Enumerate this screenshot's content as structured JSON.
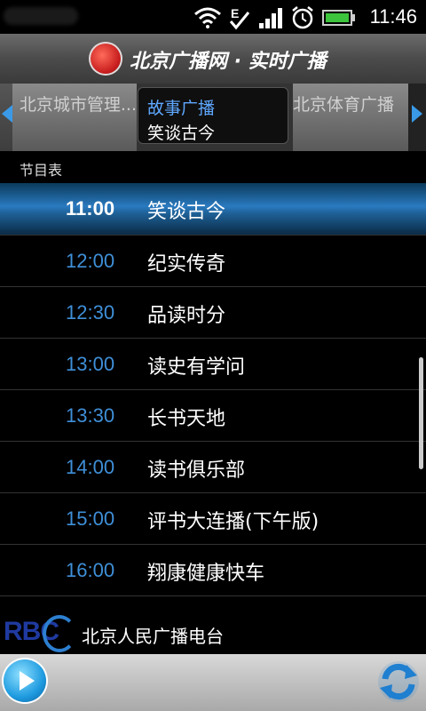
{
  "status_bar": {
    "time": "11:46",
    "icons": [
      "wifi-icon",
      "signal-E-check-icon",
      "signal-bars-icon",
      "alarm-icon",
      "battery-icon"
    ]
  },
  "header": {
    "title": "北京广播网 · 实时广播",
    "logo_icon": "beijing-radio-logo"
  },
  "channels": {
    "prev": "北京城市管理...",
    "current_channel": "故事广播",
    "current_program": "笑谈古今",
    "next": "北京体育广播"
  },
  "schedule": {
    "label": "节目表",
    "items": [
      {
        "time": "11:00",
        "program": "笑谈古今",
        "active": true
      },
      {
        "time": "12:00",
        "program": "纪实传奇"
      },
      {
        "time": "12:30",
        "program": "品读时分"
      },
      {
        "time": "13:00",
        "program": "读史有学问"
      },
      {
        "time": "13:30",
        "program": "长书天地"
      },
      {
        "time": "14:00",
        "program": "读书俱乐部"
      },
      {
        "time": "15:00",
        "program": "评书大连播(下午版)"
      },
      {
        "time": "16:00",
        "program": "翔康健康快车"
      }
    ]
  },
  "station": {
    "logo_text": "RBC",
    "name": "北京人民广播电台"
  },
  "colors": {
    "accent": "#3f8fd8",
    "header_bg": "#4b4b4b",
    "active_row": "#2a7ac0"
  }
}
